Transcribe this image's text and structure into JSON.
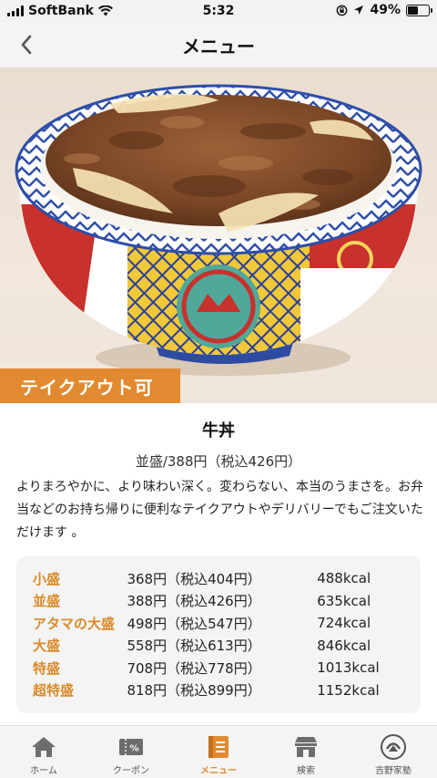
{
  "status_bar": {
    "carrier": "SoftBank",
    "time": "5:32",
    "battery": "49%",
    "battery_level": 0.49
  },
  "nav": {
    "title": "メニュー",
    "back_icon": "chevron-left-icon"
  },
  "hero": {
    "takeout_label": "テイクアウト可"
  },
  "item": {
    "name": "牛丼",
    "price_line": "並盛/388円（税込426円）",
    "description": "よりまろやかに、より味わい深く。変わらない、本当のうまさを。お弁当などのお持ち帰りに便利なテイクアウトやデリバリーでもご注文いただけます 。"
  },
  "sizes": [
    {
      "size": "小盛",
      "price": "368円（税込404円）",
      "kcal": "488kcal"
    },
    {
      "size": "並盛",
      "price": "388円（税込426円）",
      "kcal": "635kcal"
    },
    {
      "size": "アタマの大盛",
      "price": "498円（税込547円）",
      "kcal": "724kcal"
    },
    {
      "size": "大盛",
      "price": "558円（税込613円）",
      "kcal": "846kcal"
    },
    {
      "size": "特盛",
      "price": "708円（税込778円）",
      "kcal": "1013kcal"
    },
    {
      "size": "超特盛",
      "price": "818円（税込899円）",
      "kcal": "1152kcal"
    }
  ],
  "tabs": [
    {
      "label": "ホーム",
      "icon": "home-icon",
      "active": false
    },
    {
      "label": "クーポン",
      "icon": "coupon-icon",
      "active": false
    },
    {
      "label": "メニュー",
      "icon": "menu-book-icon",
      "active": true
    },
    {
      "label": "検索",
      "icon": "store-search-icon",
      "active": false
    },
    {
      "label": "吉野家塾",
      "icon": "yoshinoya-logo-icon",
      "active": false
    }
  ],
  "colors": {
    "accent": "#e28a30",
    "size_label": "#d98a28"
  }
}
